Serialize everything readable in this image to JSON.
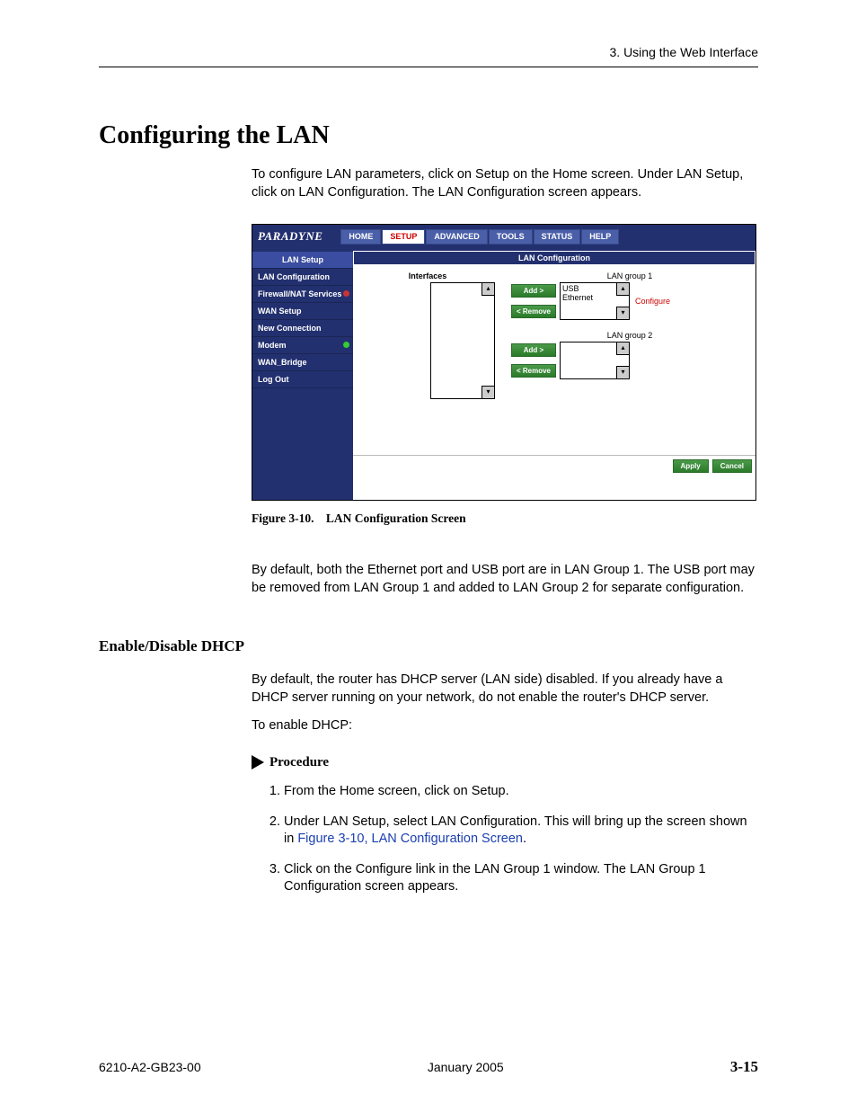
{
  "header": {
    "section": "3. Using the Web Interface"
  },
  "title": "Configuring the LAN",
  "intro": "To configure LAN parameters, click on Setup on the Home screen. Under LAN Setup, click on LAN Configuration. The LAN Configuration screen appears.",
  "screenshot": {
    "brand": "PARADYNE",
    "tabs": [
      "HOME",
      "SETUP",
      "ADVANCED",
      "TOOLS",
      "STATUS",
      "HELP"
    ],
    "active_tab": "SETUP",
    "sidebar": {
      "header": "LAN Setup",
      "items": [
        {
          "label": "LAN Configuration",
          "dot": null
        },
        {
          "label": "Firewall/NAT Services",
          "dot": "red"
        },
        {
          "label": "WAN Setup",
          "dot": null
        },
        {
          "label": "New Connection",
          "dot": null
        },
        {
          "label": "Modem",
          "dot": "green"
        },
        {
          "label": "WAN_Bridge",
          "dot": null
        },
        {
          "label": "Log Out",
          "dot": null
        }
      ]
    },
    "panel_title": "LAN Configuration",
    "interfaces_label": "Interfaces",
    "buttons": {
      "add": "Add >",
      "remove": "< Remove",
      "configure": "Configure",
      "apply": "Apply",
      "cancel": "Cancel"
    },
    "group1": {
      "title": "LAN group 1",
      "items": [
        "USB",
        "Ethernet"
      ]
    },
    "group2": {
      "title": "LAN group 2",
      "items": []
    },
    "arrow_up": "▴",
    "arrow_down": "▾"
  },
  "figure_caption": {
    "num": "Figure 3-10.",
    "title": "LAN Configuration Screen"
  },
  "after_fig": "By default, both the Ethernet port and USB port are in LAN Group 1. The USB port may be removed from LAN Group 1 and added to LAN Group 2 for separate configuration.",
  "subheading": "Enable/Disable DHCP",
  "dhcp_para1": "By default, the router has DHCP server (LAN side) disabled. If you already have a DHCP server running on your network, do not enable the router's DHCP server.",
  "dhcp_para2": "To enable DHCP:",
  "procedure_label": "Procedure",
  "steps": {
    "s1": "From the Home screen, click on Setup.",
    "s2a": "Under LAN Setup, select LAN Configuration. This will bring up the screen shown in ",
    "s2link": "Figure 3-10, LAN Configuration Screen",
    "s2b": ".",
    "s3": "Click on the Configure link in the LAN Group 1 window. The LAN Group 1 Configuration screen appears."
  },
  "footer": {
    "doc": "6210-A2-GB23-00",
    "date": "January 2005",
    "page": "3-15"
  }
}
